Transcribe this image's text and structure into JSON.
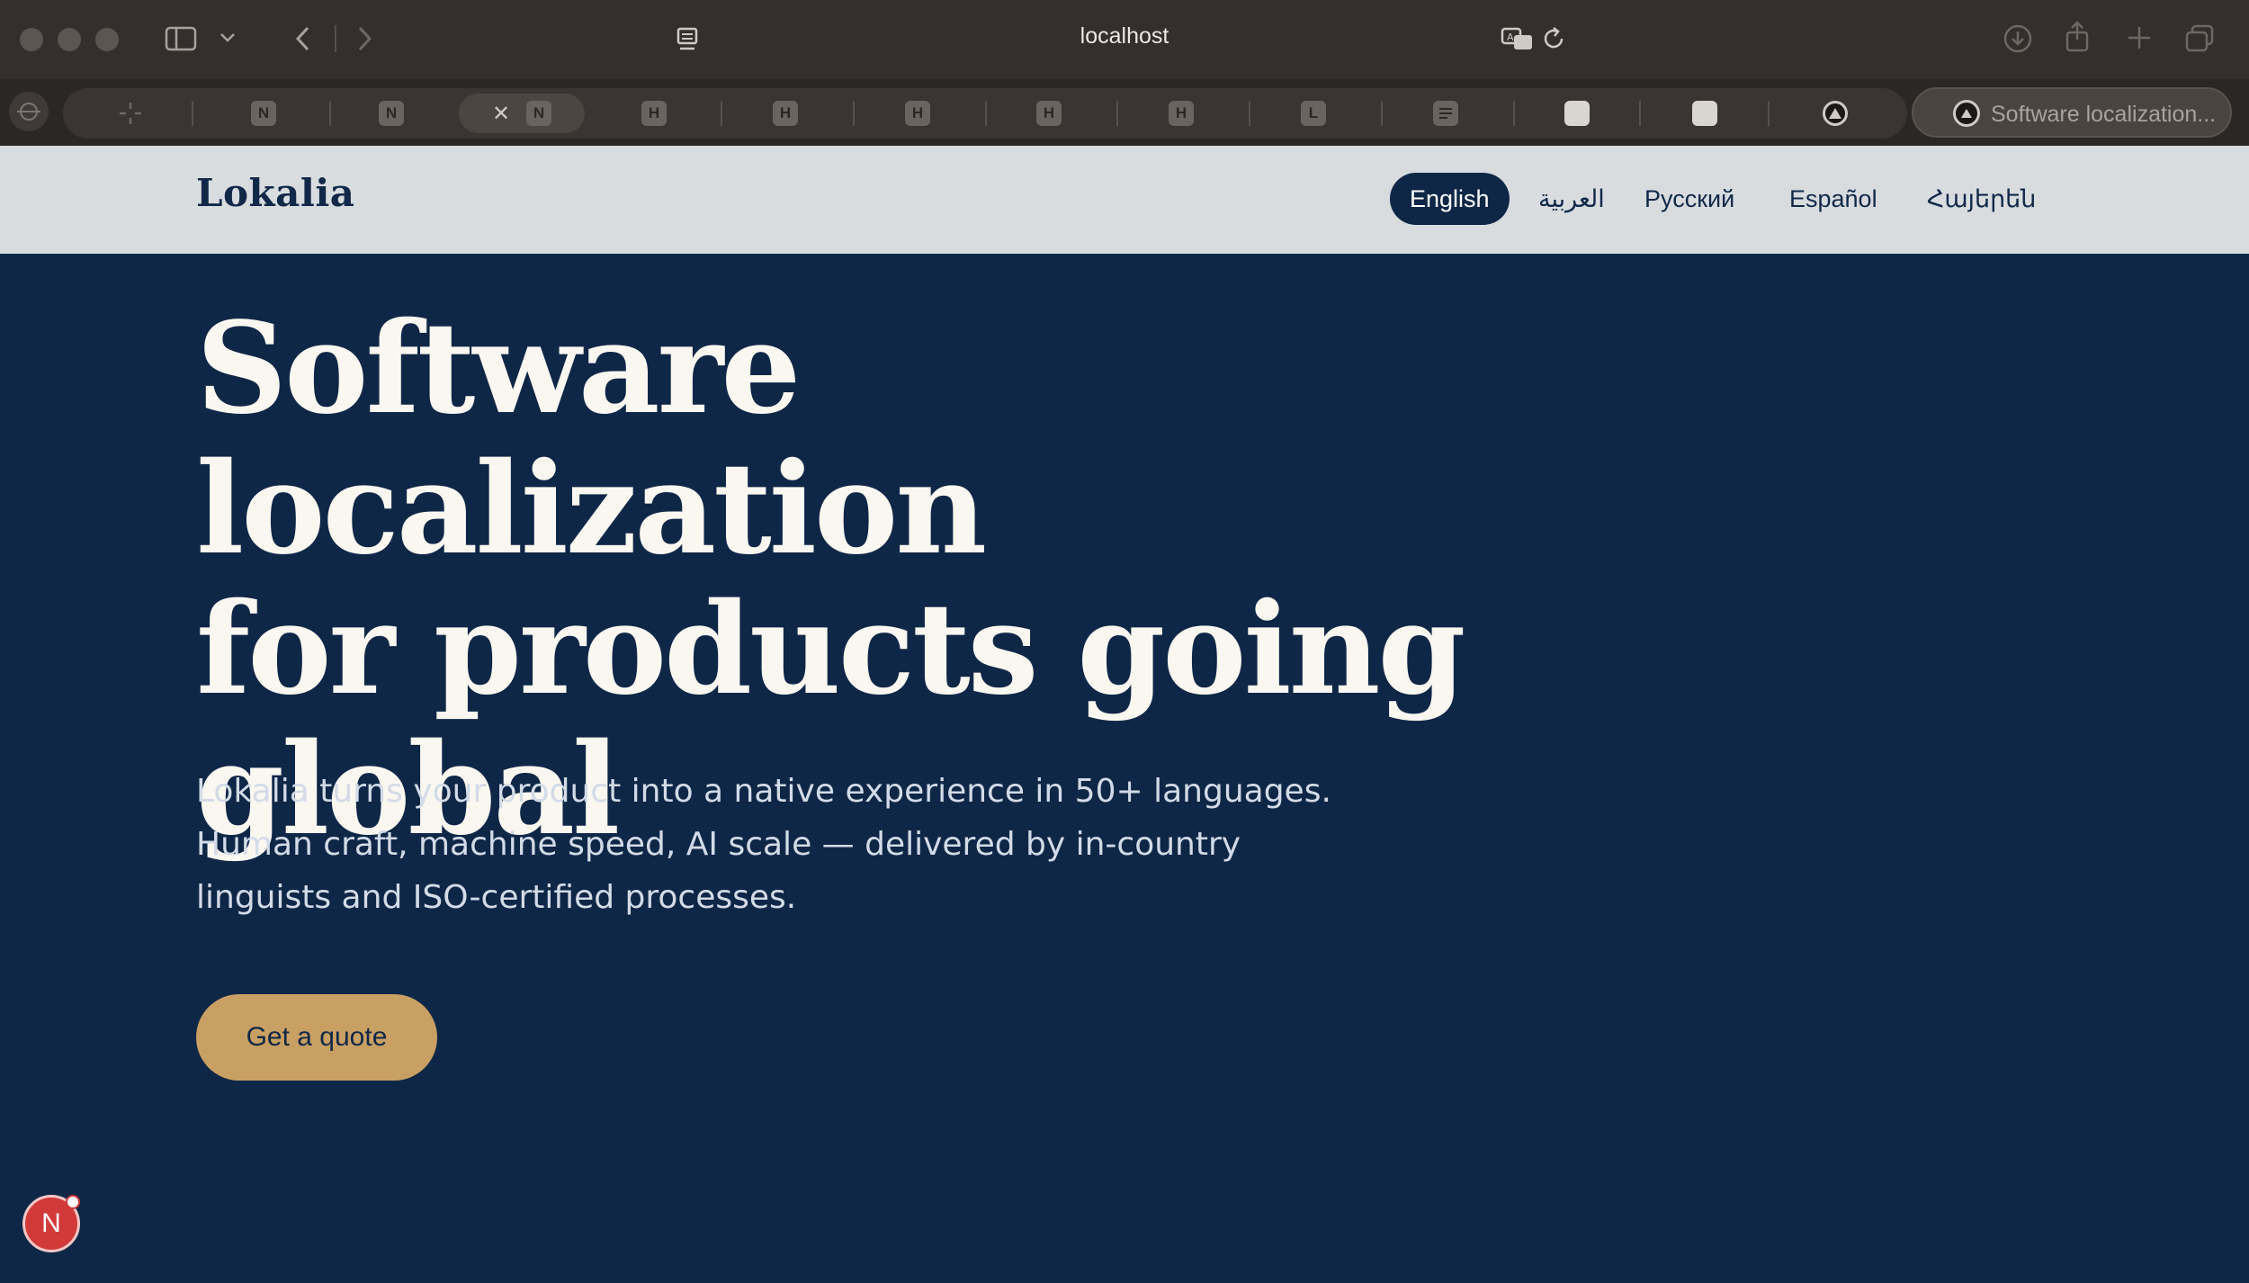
{
  "browser": {
    "url": "localhost",
    "active_tab_title": "Software localization...",
    "tabs": [
      {
        "favicon": "loading-icon",
        "letter": ""
      },
      {
        "favicon": "letter",
        "letter": "N"
      },
      {
        "favicon": "letter",
        "letter": "N"
      },
      {
        "favicon": "letter",
        "letter": "N"
      },
      {
        "favicon": "letter",
        "letter": "H"
      },
      {
        "favicon": "letter",
        "letter": "H"
      },
      {
        "favicon": "letter",
        "letter": "H"
      },
      {
        "favicon": "letter",
        "letter": "H"
      },
      {
        "favicon": "letter",
        "letter": "H"
      },
      {
        "favicon": "letter",
        "letter": "L"
      },
      {
        "favicon": "doc-icon",
        "letter": ""
      },
      {
        "favicon": "square-icon",
        "letter": ""
      },
      {
        "favicon": "square-icon",
        "letter": ""
      },
      {
        "favicon": "triangle-icon",
        "letter": ""
      }
    ]
  },
  "site": {
    "logo": "Lokalia",
    "languages": [
      "English",
      "العربية",
      "Русский",
      "Español",
      "Հայերեն"
    ],
    "active_language": "English"
  },
  "hero": {
    "title_line1": "Software localization",
    "title_line2": "for products going",
    "title_line3": "global",
    "subtitle_line1": "Lokalia turns your product into a native experience in 50+ languages.",
    "subtitle_line2": "Human craft, machine speed, AI scale — delivered by in-country",
    "subtitle_line3": "linguists and ISO-certified processes.",
    "cta": "Get a quote"
  },
  "dev_badge": {
    "letter": "N"
  },
  "colors": {
    "page_bg": "#0f2747",
    "nav_bg": "#d8dcdf",
    "accent": "#c9a063",
    "title_text": "#faf7f1"
  }
}
